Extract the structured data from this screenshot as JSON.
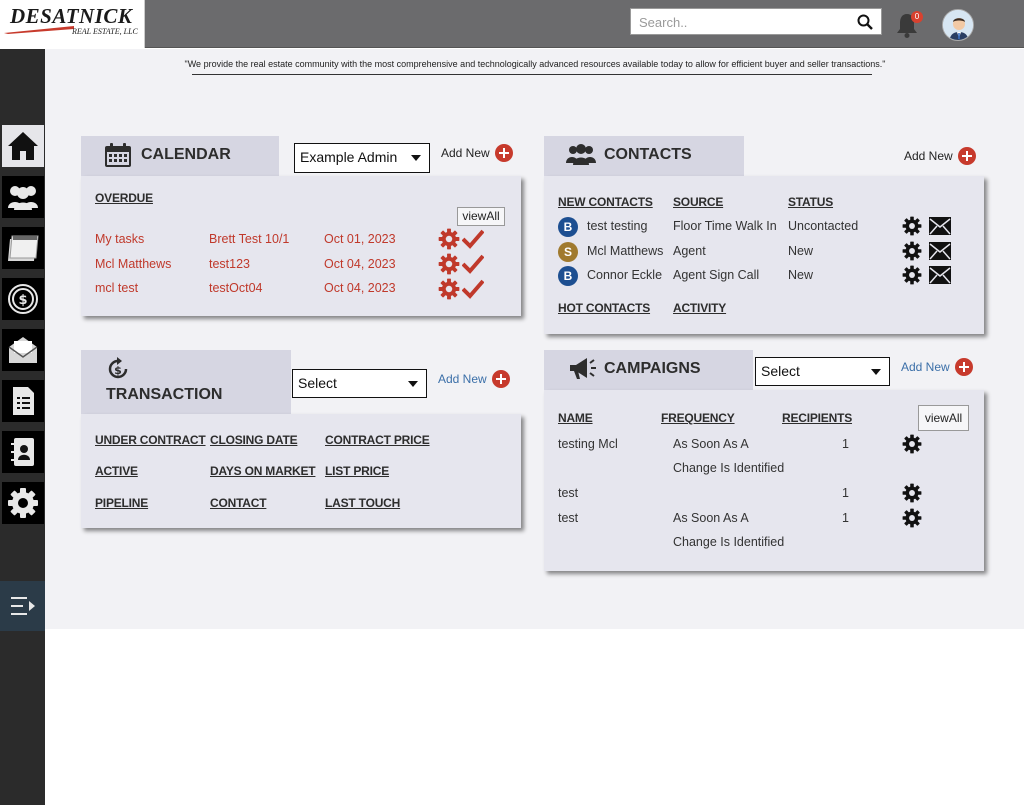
{
  "header": {
    "logo_main": "DESATNICK",
    "logo_sub": "REAL ESTATE, LLC",
    "search_placeholder": "Search..",
    "notification_count": "0"
  },
  "tagline": "\"We provide the real estate community with the most comprehensive and technologically advanced resources available today to allow for efficient buyer and seller transactions.\"",
  "sidebar": {
    "items": [
      {
        "icon": "home-icon"
      },
      {
        "icon": "users-icon"
      },
      {
        "icon": "calendar-icon"
      },
      {
        "icon": "dollar-cycle-icon"
      },
      {
        "icon": "mail-icon"
      },
      {
        "icon": "document-icon"
      },
      {
        "icon": "contact-book-icon"
      },
      {
        "icon": "gear-icon"
      }
    ],
    "active_index": 0
  },
  "calendar": {
    "title": "CALENDAR",
    "select_value": "Example Admin",
    "add_new": "Add New",
    "overdue_label": "OVERDUE",
    "view_all": "viewAll",
    "rows": [
      {
        "name": "My tasks",
        "ref": "Brett Test 10/1",
        "date": "Oct 01, 2023"
      },
      {
        "name": "Mcl Matthews",
        "ref": "test123",
        "date": "Oct 04, 2023"
      },
      {
        "name": "mcl test",
        "ref": "testOct04",
        "date": "Oct 04, 2023"
      }
    ]
  },
  "transaction": {
    "title": "TRANSACTION",
    "select_value": "Select",
    "add_new": "Add New",
    "links": {
      "under_contract": "UNDER CONTRACT",
      "closing_date": "CLOSING DATE",
      "contract_price": "CONTRACT PRICE",
      "active": "ACTIVE",
      "days_on_market": "DAYS ON MARKET",
      "list_price": "LIST PRICE",
      "pipeline": "PIPELINE",
      "contact": "CONTACT",
      "last_touch": "LAST TOUCH"
    }
  },
  "contacts": {
    "title": "CONTACTS",
    "add_new": "Add New",
    "headers": {
      "new_contacts": "NEW CONTACTS",
      "source": "SOURCE",
      "status": "STATUS"
    },
    "rows": [
      {
        "initial": "B",
        "color": "#1d4f91",
        "name": "test testing",
        "source": "Floor Time Walk In",
        "status": "Uncontacted"
      },
      {
        "initial": "S",
        "color": "#a07a2e",
        "name": "Mcl Matthews",
        "source": "Agent",
        "status": "New"
      },
      {
        "initial": "B",
        "color": "#1d4f91",
        "name": "Connor Eckle",
        "source": "Agent Sign Call",
        "status": "New"
      }
    ],
    "hot_contacts": "HOT CONTACTS",
    "activity": "ACTIVITY"
  },
  "campaigns": {
    "title": "CAMPAIGNS",
    "select_value": "Select",
    "add_new": "Add New",
    "view_all": "viewAll",
    "headers": {
      "name": "NAME",
      "frequency": "FREQUENCY",
      "recipients": "RECIPIENTS"
    },
    "rows": [
      {
        "name": "testing Mcl",
        "freq1": "As Soon As A",
        "freq2": "Change Is Identified",
        "recipients": "1"
      },
      {
        "name": "test",
        "freq1": "",
        "freq2": "",
        "recipients": "1"
      },
      {
        "name": "test",
        "freq1": "As Soon As A",
        "freq2": "Change Is Identified",
        "recipients": "1"
      }
    ]
  },
  "colors": {
    "accent_red": "#c0392b",
    "topbar": "#6b6b6d",
    "panel": "#e6e6ee",
    "tab": "#d6d6e2"
  }
}
